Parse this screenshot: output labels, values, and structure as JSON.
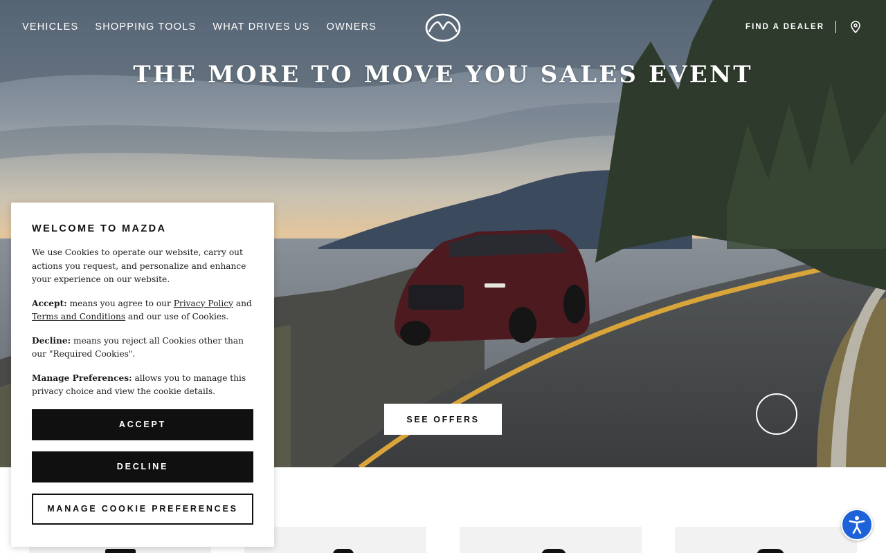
{
  "nav": {
    "links": [
      "VEHICLES",
      "SHOPPING TOOLS",
      "WHAT DRIVES US",
      "OWNERS"
    ],
    "find_dealer": "FIND A DEALER",
    "logo_icon": "mazda-logo-icon",
    "location_icon": "map-pin-icon"
  },
  "hero": {
    "title": "THE MORE TO MOVE YOU SALES EVENT",
    "cta": "SEE OFFERS",
    "play_icon": "circle-ring-icon"
  },
  "cookie": {
    "title": "WELCOME TO MAZDA",
    "intro": "We use Cookies to operate our website, carry out actions you request, and personalize and enhance your experience on our website.",
    "accept_term": "Accept:",
    "accept_text_1": " means you agree to our ",
    "privacy_link": "Privacy Policy",
    "accept_text_2": " and ",
    "terms_link": "Terms and Conditions",
    "accept_text_3": " and our use of Cookies.",
    "decline_term": "Decline:",
    "decline_text": " means you reject all Cookies other than our \"Required Cookies\".",
    "manage_term": "Manage Preferences:",
    "manage_text": " allows you to manage this privacy choice and view the cookie details.",
    "accept_button": "ACCEPT",
    "decline_button": "DECLINE",
    "manage_button": "MANAGE COOKIE PREFERENCES"
  },
  "accessibility": {
    "icon": "accessibility-icon"
  },
  "colors": {
    "accent_blue": "#1d62d8",
    "button_dark": "#101010",
    "card_bg": "#f1f2f1"
  }
}
